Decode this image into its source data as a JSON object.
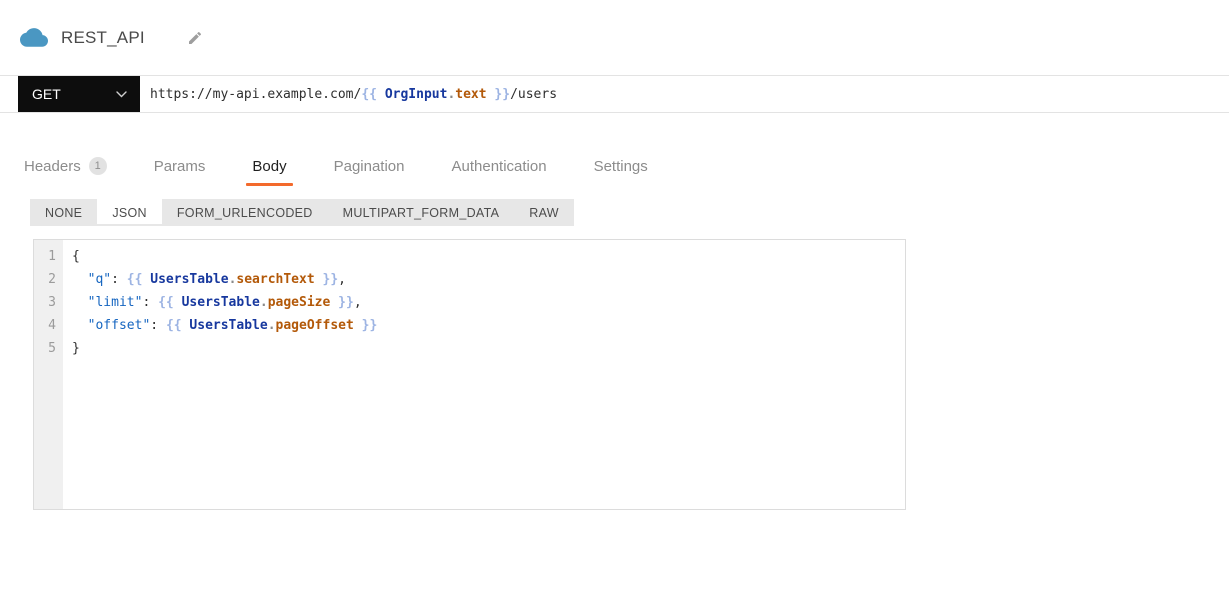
{
  "header": {
    "title": "REST_API",
    "datasource_icon": "cloud-icon",
    "edit_icon": "pencil-icon"
  },
  "request_bar": {
    "method": "GET",
    "url_tokens": [
      {
        "text": "https://my-api.example.com/",
        "type": "plain"
      },
      {
        "text": "{{ ",
        "type": "brace"
      },
      {
        "text": "OrgInput",
        "type": "entity"
      },
      {
        "text": ".",
        "type": "dot"
      },
      {
        "text": "text",
        "type": "prop"
      },
      {
        "text": " }}",
        "type": "brace"
      },
      {
        "text": "/users",
        "type": "plain"
      }
    ]
  },
  "tabs": [
    {
      "label": "Headers",
      "badge": "1",
      "active": false
    },
    {
      "label": "Params",
      "badge": null,
      "active": false
    },
    {
      "label": "Body",
      "badge": null,
      "active": true
    },
    {
      "label": "Pagination",
      "badge": null,
      "active": false
    },
    {
      "label": "Authentication",
      "badge": null,
      "active": false
    },
    {
      "label": "Settings",
      "badge": null,
      "active": false
    }
  ],
  "body_type_tabs": [
    {
      "label": "NONE",
      "active": false
    },
    {
      "label": "JSON",
      "active": true
    },
    {
      "label": "FORM_URLENCODED",
      "active": false
    },
    {
      "label": "MULTIPART_FORM_DATA",
      "active": false
    },
    {
      "label": "RAW",
      "active": false
    }
  ],
  "editor": {
    "lines": [
      {
        "number": 1,
        "tokens": [
          {
            "text": "{",
            "type": "plain"
          }
        ]
      },
      {
        "number": 2,
        "tokens": [
          {
            "text": "  ",
            "type": "plain"
          },
          {
            "text": "\"q\"",
            "type": "key"
          },
          {
            "text": ": ",
            "type": "plain"
          },
          {
            "text": "{{ ",
            "type": "brace"
          },
          {
            "text": "UsersTable",
            "type": "entity"
          },
          {
            "text": ".",
            "type": "dot"
          },
          {
            "text": "searchText",
            "type": "prop"
          },
          {
            "text": " }}",
            "type": "brace"
          },
          {
            "text": ",",
            "type": "plain"
          }
        ]
      },
      {
        "number": 3,
        "tokens": [
          {
            "text": "  ",
            "type": "plain"
          },
          {
            "text": "\"limit\"",
            "type": "key"
          },
          {
            "text": ": ",
            "type": "plain"
          },
          {
            "text": "{{ ",
            "type": "brace"
          },
          {
            "text": "UsersTable",
            "type": "entity"
          },
          {
            "text": ".",
            "type": "dot"
          },
          {
            "text": "pageSize",
            "type": "prop"
          },
          {
            "text": " }}",
            "type": "brace"
          },
          {
            "text": ",",
            "type": "plain"
          }
        ]
      },
      {
        "number": 4,
        "tokens": [
          {
            "text": "  ",
            "type": "plain"
          },
          {
            "text": "\"offset\"",
            "type": "key"
          },
          {
            "text": ": ",
            "type": "plain"
          },
          {
            "text": "{{ ",
            "type": "brace"
          },
          {
            "text": "UsersTable",
            "type": "entity"
          },
          {
            "text": ".",
            "type": "dot"
          },
          {
            "text": "pageOffset",
            "type": "prop"
          },
          {
            "text": " }}",
            "type": "brace"
          }
        ]
      },
      {
        "number": 5,
        "tokens": [
          {
            "text": "}",
            "type": "plain"
          }
        ]
      }
    ]
  },
  "colors": {
    "accent_orange": "#f36a2c",
    "method_bg": "#0d0d0d",
    "cloud_blue": "#4a97c2",
    "token_key": "#1565c0",
    "token_brace": "#9db4e3",
    "token_entity": "#17389e",
    "token_property": "#b35909",
    "token_dot": "#8a8a8a"
  }
}
